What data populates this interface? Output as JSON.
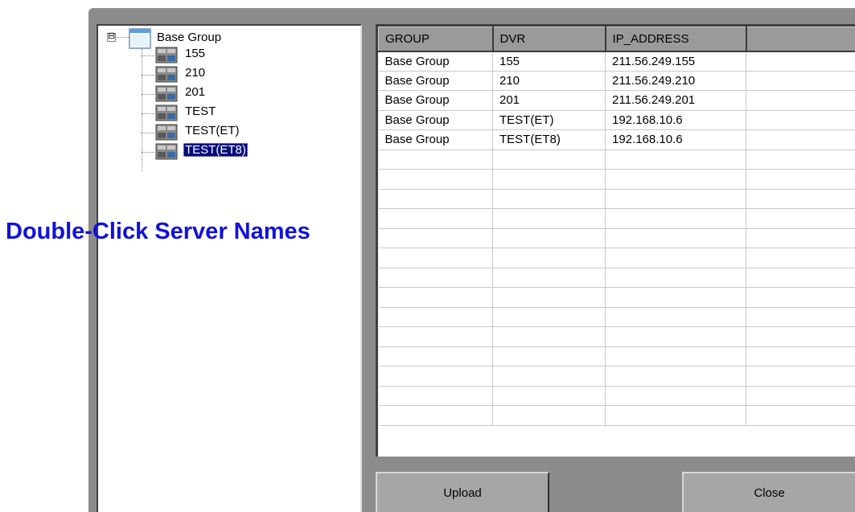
{
  "tree": {
    "root": {
      "label": "Base Group",
      "expander": "⊟",
      "icon": "folder-icon"
    },
    "nodes": [
      {
        "label": "155",
        "icon": "dvr-server-icon",
        "selected": false
      },
      {
        "label": "210",
        "icon": "dvr-server-icon",
        "selected": false
      },
      {
        "label": "201",
        "icon": "dvr-server-icon",
        "selected": false
      },
      {
        "label": "TEST",
        "icon": "dvr-server-icon",
        "selected": false
      },
      {
        "label": "TEST(ET)",
        "icon": "dvr-server-icon",
        "selected": false
      },
      {
        "label": "TEST(ET8)",
        "icon": "dvr-server-icon",
        "selected": true
      }
    ]
  },
  "grid": {
    "columns": [
      "GROUP",
      "DVR",
      "IP_ADDRESS",
      ""
    ],
    "rows": [
      [
        "Base Group",
        "155",
        "211.56.249.155",
        ""
      ],
      [
        "Base Group",
        "210",
        "211.56.249.210",
        ""
      ],
      [
        "Base Group",
        "201",
        "211.56.249.201",
        ""
      ],
      [
        "Base Group",
        "TEST(ET)",
        "192.168.10.6",
        ""
      ],
      [
        "Base Group",
        "TEST(ET8)",
        "192.168.10.6",
        ""
      ]
    ],
    "empty_rows": 14
  },
  "buttons": {
    "upload_label": "Upload",
    "close_label": "Close"
  },
  "annotation": {
    "text": "Double-Click Server Names"
  },
  "colors": {
    "window_bg": "#8c8c8c",
    "selection_bg": "#000a7b",
    "annotation_text": "#1111dd"
  }
}
